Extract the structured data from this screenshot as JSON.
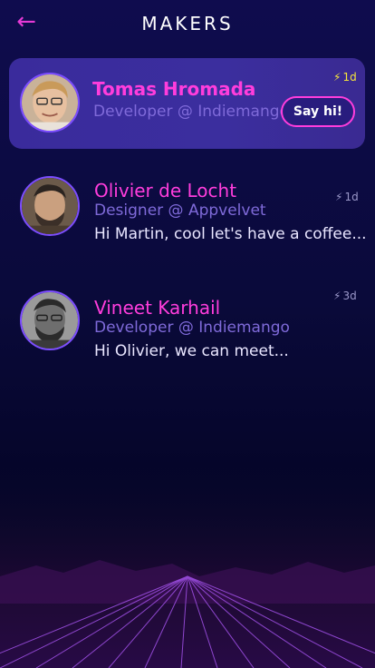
{
  "header": {
    "title": "MAKERS",
    "back_icon": "arrow-left-icon"
  },
  "colors": {
    "accent": "#ff3ddc",
    "role": "#7f6ad9",
    "highlight": "#f7e73a",
    "background": "#0f0c4e"
  },
  "featured": {
    "name": "Tomas Hromada",
    "role": "Developer @ Indiemango",
    "time": "1d",
    "action": "Say hi!"
  },
  "messages": [
    {
      "name": "Olivier de Locht",
      "role": "Designer @ Appvelvet",
      "preview": "Hi Martin, cool let's have a coffee...",
      "time": "1d"
    },
    {
      "name": "Vineet Karhail",
      "role": "Developer @ Indiemango",
      "preview": "Hi Olivier, we can meet...",
      "time": "3d"
    }
  ]
}
